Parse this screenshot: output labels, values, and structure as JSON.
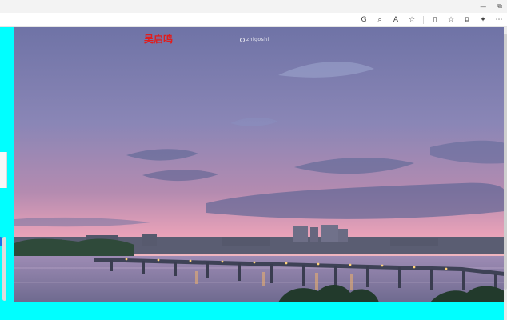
{
  "browser": {
    "window_controls": {
      "minimize": "—",
      "restore": "⧉"
    },
    "toolbar_icons": [
      {
        "name": "translate-icon",
        "glyph": "G"
      },
      {
        "name": "zoom-icon",
        "glyph": "⌕"
      },
      {
        "name": "read-aloud-icon",
        "glyph": "A"
      },
      {
        "name": "favorite-icon",
        "glyph": "☆"
      },
      {
        "name": "split-screen-icon",
        "glyph": "▯"
      },
      {
        "name": "favorites-list-icon",
        "glyph": "☆"
      },
      {
        "name": "collections-icon",
        "glyph": "⧉"
      },
      {
        "name": "extensions-icon",
        "glyph": "✦"
      },
      {
        "name": "more-icon",
        "glyph": "⋯"
      }
    ]
  },
  "page": {
    "caption": "吴启鸣",
    "watermark": "zhigoshi",
    "background_color": "#00ffff"
  }
}
